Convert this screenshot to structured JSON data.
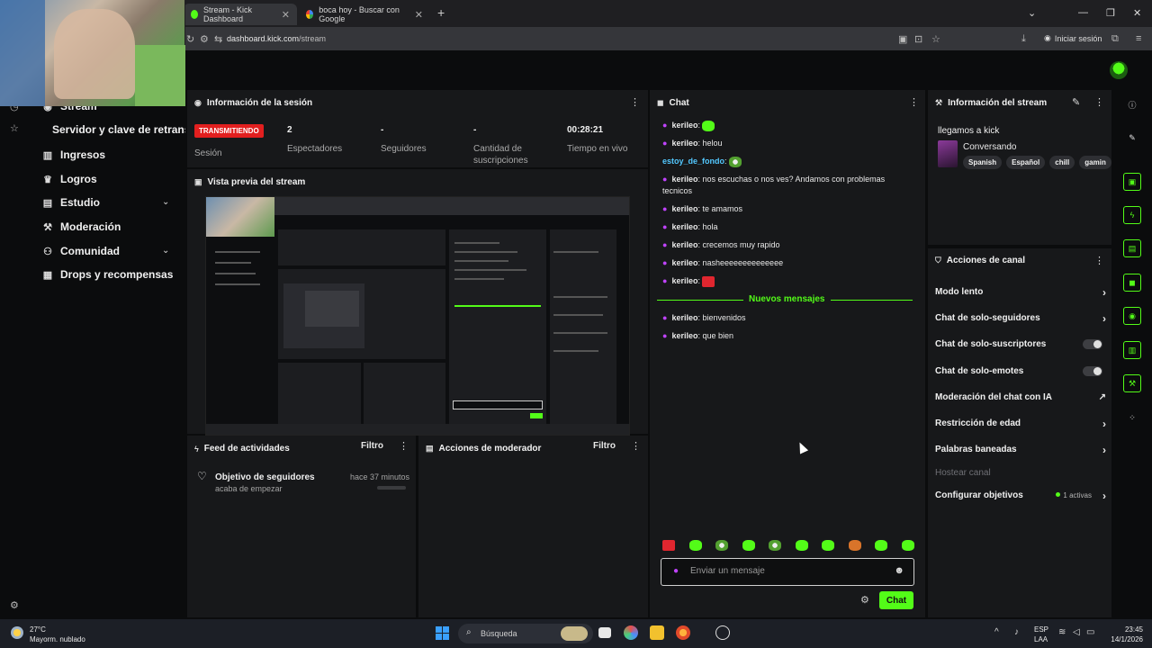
{
  "browser": {
    "tabs": [
      {
        "title": "Stream - Kick Dashboard",
        "active": true
      },
      {
        "title": "boca hoy - Buscar con Google",
        "active": false
      }
    ],
    "url_host": "dashboard.kick.com",
    "url_path": "/stream",
    "signin_label": "Iniciar sesión"
  },
  "sidebar": {
    "items": [
      {
        "label": "Stream",
        "icon": "broadcast-icon"
      },
      {
        "label": "Servidor y clave de retransmisión",
        "icon": ""
      },
      {
        "label": "Ingresos",
        "icon": "chart-icon"
      },
      {
        "label": "Logros",
        "icon": "trophy-icon"
      },
      {
        "label": "Estudio",
        "icon": "studio-icon"
      },
      {
        "label": "Moderación",
        "icon": "wrench-icon"
      },
      {
        "label": "Comunidad",
        "icon": "community-icon"
      },
      {
        "label": "Drops y recompensas",
        "icon": "gift-icon"
      }
    ]
  },
  "session": {
    "title": "Información de la sesión",
    "live_badge": "TRANSMITIENDO",
    "session_label": "Sesión",
    "stats": [
      {
        "value": "2",
        "label": "Espectadores"
      },
      {
        "value": "-",
        "label": "Seguidores"
      },
      {
        "value": "-",
        "label": "Cantidad de suscripciones"
      },
      {
        "value": "00:28:21",
        "label": "Tiempo en vivo"
      }
    ]
  },
  "preview": {
    "title": "Vista previa del stream"
  },
  "activity": {
    "title": "Feed de actividades",
    "filter_label": "Filtro",
    "items": [
      {
        "title": "Objetivo de seguidores",
        "subtitle": "acaba de empezar",
        "time": "hace 37 minutos"
      }
    ]
  },
  "mod_actions": {
    "title": "Acciones de moderador",
    "filter_label": "Filtro"
  },
  "chat": {
    "title": "Chat",
    "messages": [
      {
        "user": "kerileo",
        "text": "",
        "emote": "green",
        "mic": true,
        "user_color": "#e8e8e8"
      },
      {
        "user": "kerileo",
        "text": "helou",
        "emote": "",
        "mic": true,
        "user_color": "#e8e8e8"
      },
      {
        "user": "estoy_de_fondo",
        "text": "",
        "emote": "gray",
        "mic": false,
        "user_color": "#53c8ff"
      },
      {
        "user": "kerileo",
        "text": "nos escuchas o nos ves? Andamos con problemas tecnicos",
        "emote": "",
        "mic": true,
        "user_color": "#e8e8e8"
      },
      {
        "user": "kerileo",
        "text": "te amamos",
        "emote": "",
        "mic": true,
        "user_color": "#e8e8e8"
      },
      {
        "user": "kerileo",
        "text": "hola",
        "emote": "",
        "mic": true,
        "user_color": "#e8e8e8"
      },
      {
        "user": "kerileo",
        "text": "crecemos muy rapido",
        "emote": "",
        "mic": true,
        "user_color": "#e8e8e8"
      },
      {
        "user": "kerileo",
        "text": "nasheeeeeeeeeeeeee",
        "emote": "",
        "mic": true,
        "user_color": "#e8e8e8"
      },
      {
        "user": "kerileo",
        "text": "",
        "emote": "red",
        "mic": true,
        "user_color": "#e8e8e8"
      },
      {
        "user": "kerileo",
        "text": "bienvenidos",
        "emote": "",
        "mic": true,
        "user_color": "#e8e8e8"
      },
      {
        "user": "kerileo",
        "text": "que bien",
        "emote": "",
        "mic": true,
        "user_color": "#e8e8e8"
      }
    ],
    "new_messages_label": "Nuevos mensajes",
    "input_placeholder": "Enviar un mensaje",
    "send_label": "Chat"
  },
  "stream_info": {
    "title": "Información del stream",
    "stream_title": "llegamos a kick",
    "category": "Conversando",
    "tags": [
      "Spanish",
      "Español",
      "chill",
      "gamin"
    ]
  },
  "channel_actions": {
    "title": "Acciones de canal",
    "rows": [
      {
        "label": "Modo lento",
        "control": "chevron"
      },
      {
        "label": "Chat de solo-seguidores",
        "control": "chevron"
      },
      {
        "label": "Chat de solo-suscriptores",
        "control": "toggle"
      },
      {
        "label": "Chat de solo-emotes",
        "control": "toggle"
      },
      {
        "label": "Moderación del chat con IA",
        "control": "external"
      },
      {
        "label": "Restricción de edad",
        "control": "chevron"
      },
      {
        "label": "Palabras baneadas",
        "control": "chevron"
      },
      {
        "label": "Hostear canal",
        "control": "disabled"
      },
      {
        "label": "Configurar objetivos",
        "control": "chevron",
        "extra": "1 activas"
      }
    ]
  },
  "taskbar": {
    "temperature": "27°C",
    "weather": "Mayorm. nublado",
    "search_label": "Búsqueda",
    "lang_top": "ESP",
    "lang_bottom": "LAA",
    "time": "23:45",
    "date": "14/1/2026"
  },
  "colors": {
    "accent": "#53fc18",
    "live": "#e21f1f",
    "mic": "#c043ff"
  }
}
